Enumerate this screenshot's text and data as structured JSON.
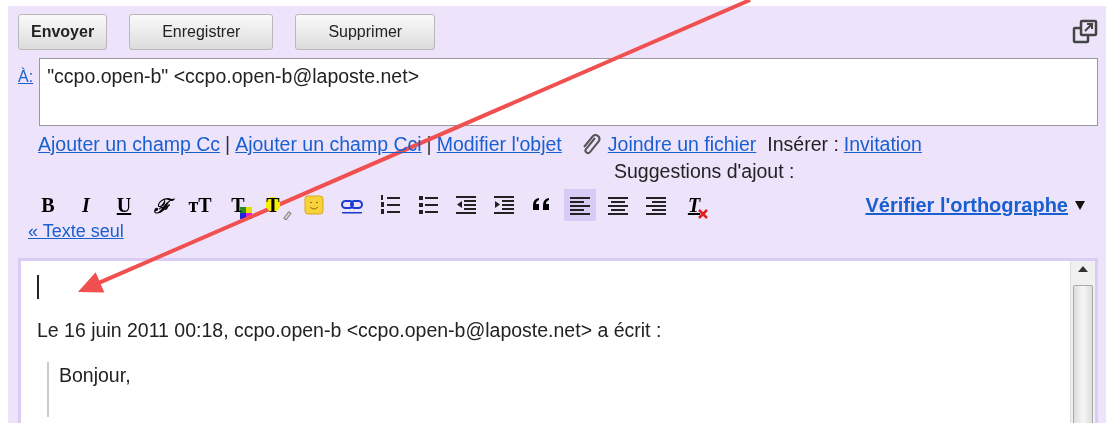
{
  "buttons": [
    {
      "label": "Envoyer",
      "kind": "primary"
    },
    {
      "label": "Enregistrer",
      "kind": "normal"
    },
    {
      "label": "Supprimer",
      "kind": "normal"
    }
  ],
  "to": {
    "label": "À:",
    "value": "\"ccpo.open-b\" <ccpo.open-b@laposte.net>"
  },
  "links": [
    {
      "label": "Ajouter un champ Cc"
    },
    {
      "separator": "|",
      "label": "Ajouter un champ Cci"
    },
    {
      "separator": "|",
      "label": "Modifier l'objet"
    }
  ],
  "attach": "Joindre un fichier",
  "insert": {
    "label": "Insérer :",
    "link": "Invitation"
  },
  "suggestions": "Suggestions d'ajout :",
  "toolbar": [
    {
      "kind": "bold",
      "label": "B",
      "selected": false
    },
    {
      "kind": "italic",
      "label": "I",
      "selected": false
    },
    {
      "kind": "underline",
      "label": "U",
      "selected": false
    },
    {
      "kind": "font",
      "label": "ℱ",
      "selected": false
    },
    {
      "kind": "size",
      "label": "тT",
      "selected": false
    },
    {
      "kind": "textcolor",
      "label": "T",
      "selected": false
    },
    {
      "kind": "highlight",
      "label": "T",
      "selected": false
    },
    {
      "kind": "emoji",
      "selected": false
    },
    {
      "kind": "link",
      "selected": false
    },
    {
      "kind": "numbered",
      "selected": false
    },
    {
      "kind": "bullets",
      "selected": false
    },
    {
      "kind": "outdent",
      "selected": false
    },
    {
      "kind": "indent",
      "selected": false
    },
    {
      "kind": "quote",
      "selected": false
    },
    {
      "kind": "alignleft",
      "selected": true
    },
    {
      "kind": "aligncenter",
      "selected": false
    },
    {
      "kind": "alignright",
      "selected": false
    },
    {
      "kind": "clear",
      "label": "T",
      "selected": false
    }
  ],
  "spellcheck": "Vérifier l'orthographe",
  "plain_text": "« Texte seul",
  "body": {
    "quote_header": "Le 16 juin 2011 00:18, ccpo.open-b <ccpo.open-b@laposte.net> a écrit :",
    "quoted": "Bonjour,"
  }
}
